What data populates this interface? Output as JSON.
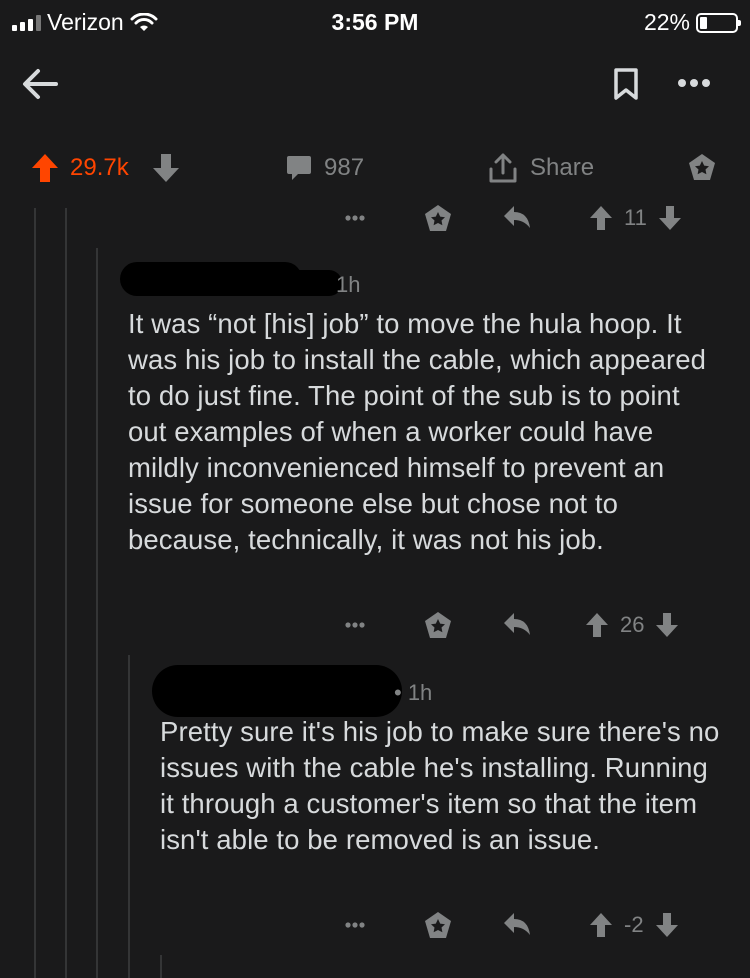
{
  "status_bar": {
    "carrier": "Verizon",
    "time": "3:56 PM",
    "battery_percent": "22%"
  },
  "post": {
    "score": "29.7k",
    "comment_count": "987",
    "share_label": "Share"
  },
  "parent_comment_actions": {
    "score": "11"
  },
  "comments": [
    {
      "meta_time": "1h",
      "body": "It was “not [his] job” to move the hula hoop. It was his job to install the cable, which appeared to do just fine.  The point of the sub is to point out examples of when a worker could have mildly inconvenienced himself to prevent an issue for someone else but chose not to because, technically, it was not his job.",
      "score": "26"
    },
    {
      "meta_time": "• 1h",
      "body": "Pretty sure it's his job to make sure there's no issues with the cable he's installing. Running it through a customer's item so that the item isn't able to be removed is an issue.",
      "score": "-2"
    }
  ],
  "colors": {
    "background": "#1a1a1b",
    "upvote_accent": "#ff4500",
    "text": "#d7dadc",
    "muted": "#818384"
  },
  "icons": [
    "back-arrow-icon",
    "bookmark-icon",
    "more-icon",
    "upvote-icon",
    "downvote-icon",
    "comment-icon",
    "share-icon",
    "award-icon",
    "reply-icon"
  ]
}
